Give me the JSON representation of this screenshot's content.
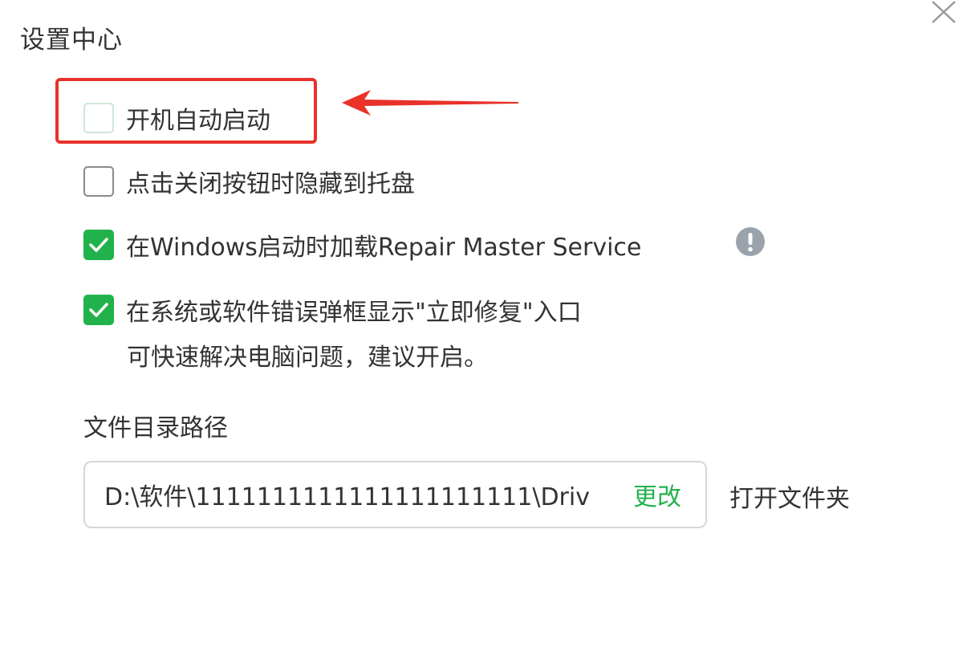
{
  "dialog": {
    "title": "设置中心",
    "close_icon": "close-icon"
  },
  "options": [
    {
      "label": "开机自动启动",
      "checked": false
    },
    {
      "label": "点击关闭按钮时隐藏到托盘",
      "checked": false
    },
    {
      "label": "在Windows启动时加载Repair Master Service",
      "checked": true
    },
    {
      "label": "在系统或软件错误弹框显示\"立即修复\"入口",
      "checked": true,
      "sublabel": "可快速解决电脑问题，建议开启。"
    }
  ],
  "info_icon": "info-exclamation-icon",
  "directory": {
    "label": "文件目录路径",
    "path_value": "D:\\软件\\1111111111111111111111\\Driv",
    "change_label": "更改",
    "open_folder_label": "打开文件夹"
  },
  "colors": {
    "accent_green": "#22b24c",
    "highlight_red": "#e8322a",
    "text": "#333333"
  }
}
